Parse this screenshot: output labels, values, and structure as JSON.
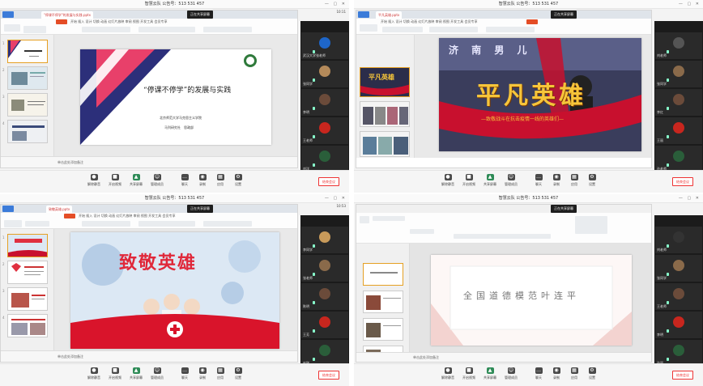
{
  "window": {
    "title": "智慧云队 公告号：513 531 457",
    "share_banner": "正在共享屏幕"
  },
  "clocks": {
    "q1": "10:11",
    "q3": "10:53"
  },
  "toolbar": {
    "items": [
      "解除静音",
      "开启视频",
      "共享屏幕",
      "管理成员",
      "聊天",
      "录制",
      "应用",
      "设置"
    ],
    "end_label": "结束会议"
  },
  "ribbon_tabs": "开始 插入 设计 切换 动画 幻灯片放映 审阅 视图 开发工具 会员专享",
  "q1": {
    "doc_tab": "\"停课不停学\"的发展与实践.pptx",
    "slide_title": "“停课不停学”的发展与实践",
    "slide_subtitle": "北京师范大学马克思主义学院",
    "slide_author": "马列研究社　思政部",
    "notes": "单击此处添加备注"
  },
  "q2": {
    "doc_tab": "平凡英雄.pptx",
    "slide_title": "平凡英雄",
    "slide_caption": "—致敬战斗在抗击疫情一线的英雄们—",
    "slide_top": "济 南 男 儿",
    "thumb1_title": "平凡英雄"
  },
  "q3": {
    "doc_tab": "致敬英雄.pptx",
    "slide_title": "致敬英雄",
    "notes": "单击此处添加备注"
  },
  "q4": {
    "slide_title": "全国道德模范叶连平",
    "notes": "单击此处添加备注"
  },
  "participants": {
    "q1": [
      "武汉大学张老师",
      "张同学",
      "李明",
      "王老师",
      "刘洋"
    ],
    "q2": [
      "刘老师",
      "张同学",
      "李红",
      "王丽",
      "孙老师"
    ],
    "q3": [
      "李同学",
      "张老师",
      "陈明",
      "王芳",
      "赵刚"
    ],
    "q4": [
      "刘老师",
      "张同学",
      "王老师",
      "李明",
      "孙丽"
    ]
  },
  "colors": {
    "accent_red": "#e33333",
    "navy": "#2c2f7a",
    "pink": "#e8406a",
    "gold": "#f6c53a",
    "participants_bg": "#1b1b1b"
  }
}
